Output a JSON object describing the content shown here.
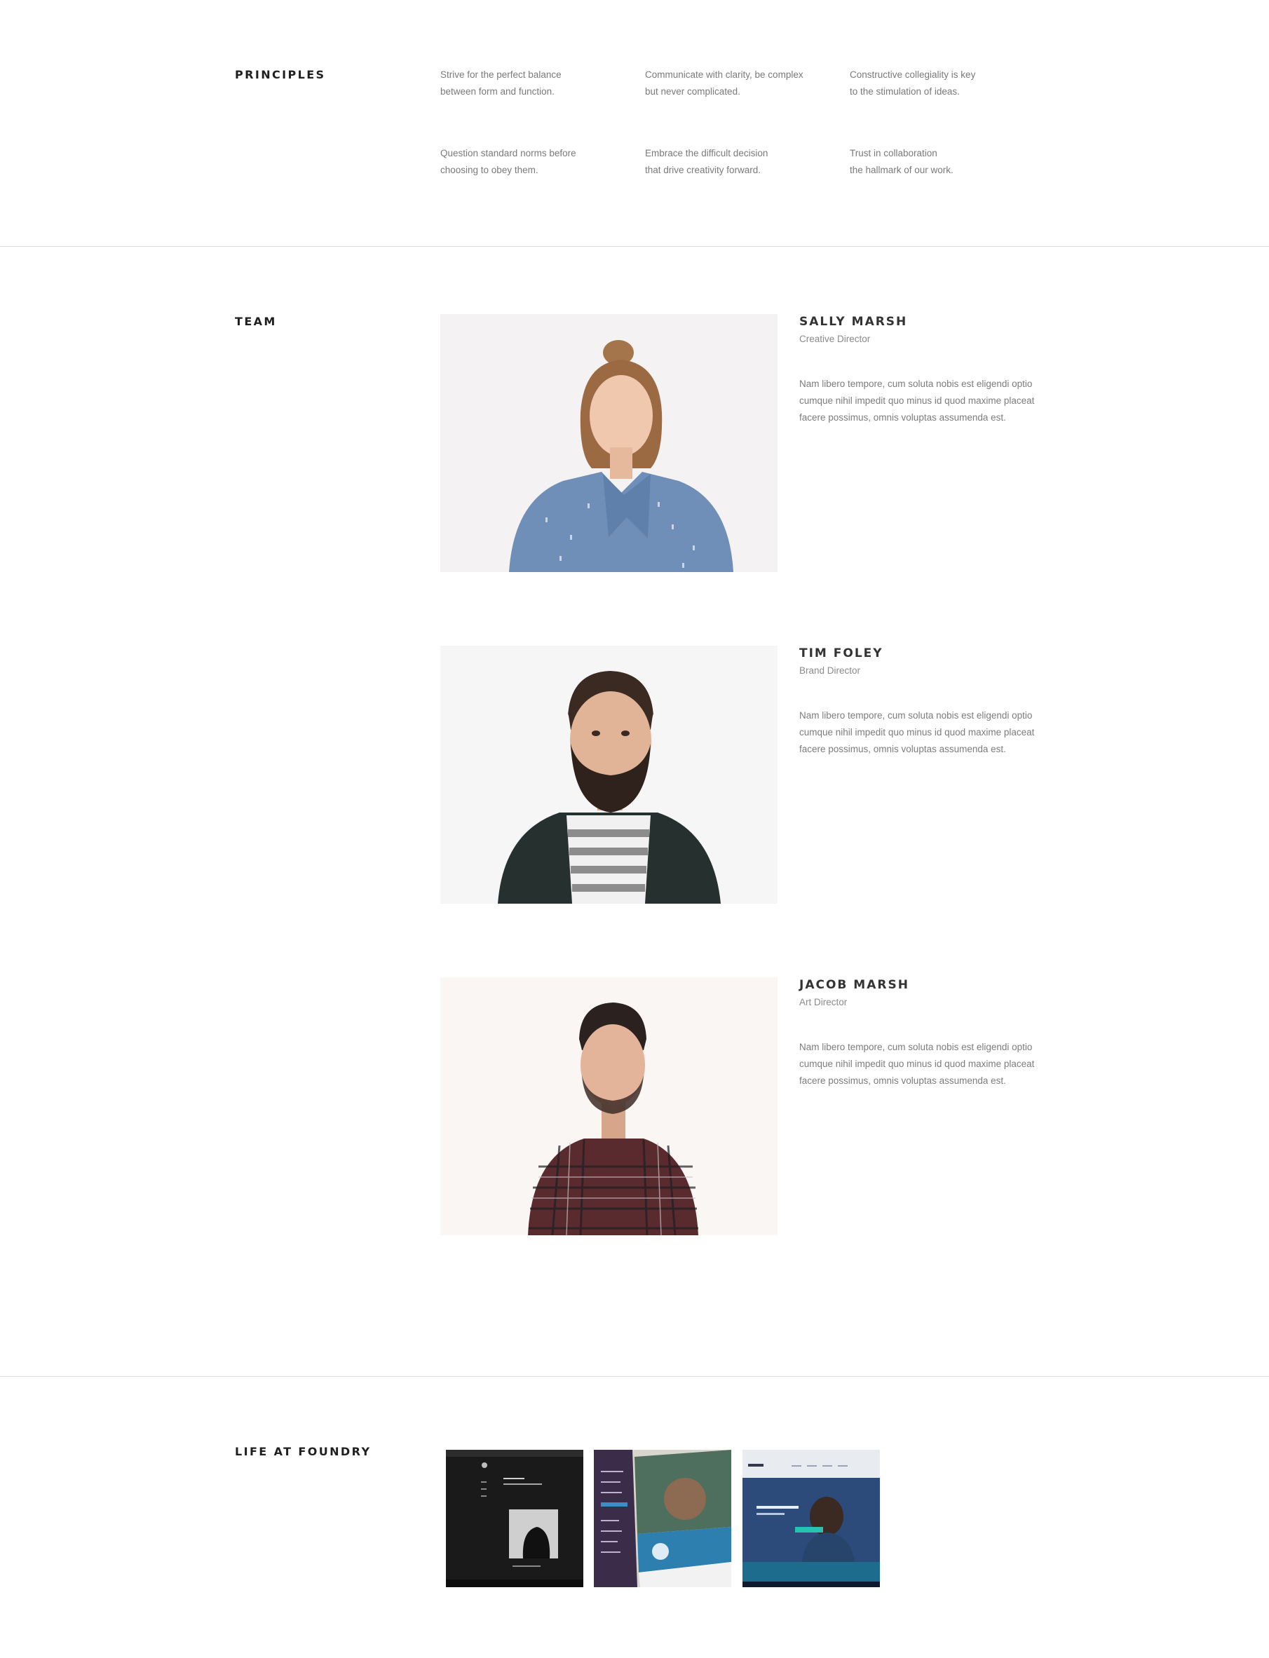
{
  "principles": {
    "heading": "PRINCIPLES",
    "items": [
      {
        "line1": "Strive for the perfect balance",
        "line2": "between form and function."
      },
      {
        "line1": "Communicate with clarity, be complex",
        "line2": "but never complicated."
      },
      {
        "line1": "Constructive collegiality is key",
        "line2": "to the stimulation of ideas."
      },
      {
        "line1": "Question standard norms before",
        "line2": "choosing to obey them."
      },
      {
        "line1": "Embrace the difficult decision",
        "line2": "that drive creativity forward."
      },
      {
        "line1": "Trust in collaboration",
        "line2": "the hallmark of our work."
      }
    ]
  },
  "team": {
    "heading": "TEAM",
    "members": [
      {
        "name": "SALLY MARSH",
        "role": "Creative Director",
        "bio": "Nam libero tempore, cum soluta nobis est eligendi optio cumque nihil impedit quo minus id quod maxime placeat facere possimus, omnis voluptas assumenda est."
      },
      {
        "name": "TIM FOLEY",
        "role": "Brand Director",
        "bio": "Nam libero tempore, cum soluta nobis est eligendi optio cumque nihil impedit quo minus id quod maxime placeat facere possimus, omnis voluptas assumenda est."
      },
      {
        "name": "JACOB MARSH",
        "role": "Art Director",
        "bio": "Nam libero tempore, cum soluta nobis est eligendi optio cumque nihil impedit quo minus id quod maxime placeat facere possimus, omnis voluptas assumenda est."
      }
    ]
  },
  "life": {
    "heading": "LIFE AT FOUNDRY",
    "photos": [
      "life-photo-dark-website",
      "life-photo-purple-website",
      "life-photo-blue-website"
    ]
  },
  "colors": {
    "heading": "#1f1f1f",
    "body_text": "#7a7a7a",
    "divider": "#dcdcdc",
    "background": "#ffffff"
  }
}
